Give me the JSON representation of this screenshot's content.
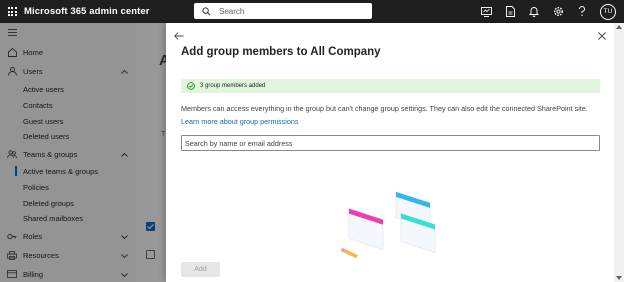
{
  "topbar": {
    "app_title": "Microsoft 365 admin center",
    "search_placeholder": "Search",
    "avatar_initials": "TU",
    "icons": [
      "screen-icon",
      "document-icon",
      "bell-icon",
      "gear-icon",
      "help-icon"
    ]
  },
  "nav": {
    "items": [
      {
        "label": "Home",
        "icon": "home-icon",
        "has_chevron": false
      },
      {
        "label": "Users",
        "icon": "user-icon",
        "has_chevron": true,
        "expanded": true
      },
      {
        "label": "Active users"
      },
      {
        "label": "Contacts"
      },
      {
        "label": "Guest users"
      },
      {
        "label": "Deleted users"
      },
      {
        "label": "Teams & groups",
        "icon": "group-icon",
        "has_chevron": true,
        "expanded": true
      },
      {
        "label": "Active teams & groups",
        "active": true
      },
      {
        "label": "Policies"
      },
      {
        "label": "Deleted groups"
      },
      {
        "label": "Shared mailboxes"
      },
      {
        "label": "Roles",
        "icon": "key-icon",
        "has_chevron": true
      },
      {
        "label": "Resources",
        "icon": "printer-icon",
        "has_chevron": true
      },
      {
        "label": "Billing",
        "icon": "card-icon",
        "has_chevron": true
      }
    ]
  },
  "background_page": {
    "title_fragment": "A",
    "tab_fragment": "T"
  },
  "panel": {
    "title": "Add group members to All Company",
    "success_message": "3 group members added",
    "description": "Members can access everything in the group but can't change group settings. They can also edit the connected SharePoint site.",
    "learn_more_link": "Learn more about group permissions",
    "search_placeholder": "Search by name or email address",
    "add_button_label": "Add",
    "add_button_disabled": true
  },
  "colors": {
    "topbar_bg": "#1f1f1f",
    "accent": "#0f6cbd",
    "success_bg": "#dff6dd",
    "success_icon": "#107c10"
  }
}
